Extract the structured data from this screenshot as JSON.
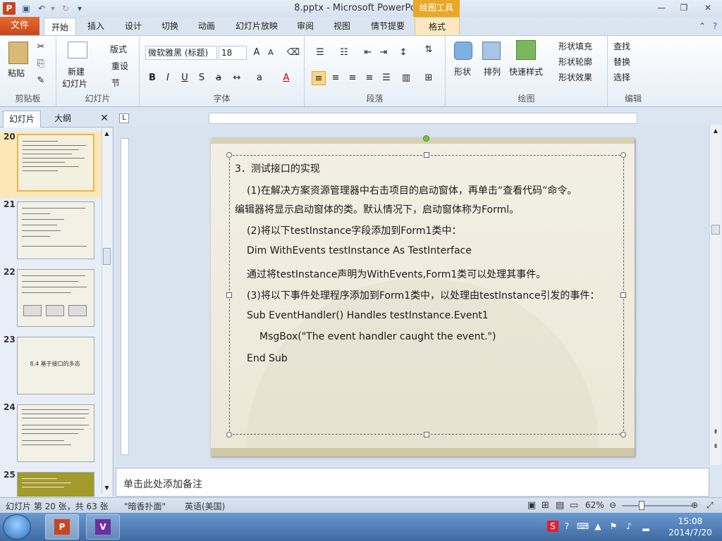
{
  "titlebar": {
    "title": "8.pptx - Microsoft PowerPoint",
    "context_tool": "绘图工具"
  },
  "tabs": {
    "file": "文件",
    "home": "开始",
    "insert": "插入",
    "design": "设计",
    "transitions": "切换",
    "animations": "动画",
    "slideshow": "幻灯片放映",
    "review": "审阅",
    "view": "视图",
    "storyboard": "情节提要",
    "format": "格式"
  },
  "ribbon": {
    "clipboard": {
      "label": "剪贴板",
      "paste": "粘贴"
    },
    "slides": {
      "label": "幻灯片",
      "new_slide_1": "新建",
      "new_slide_2": "幻灯片",
      "layout": "版式",
      "reset": "重设",
      "section": "节"
    },
    "font": {
      "label": "字体",
      "font_name": "微软雅黑 (标题)",
      "font_size": "18"
    },
    "paragraph": {
      "label": "段落"
    },
    "drawing": {
      "label": "绘图",
      "shape": "形状",
      "arrange": "排列",
      "quick_styles": "快速样式",
      "shape_fill": "形状填充",
      "shape_outline": "形状轮廓",
      "shape_effects": "形状效果"
    },
    "editing": {
      "label": "编辑",
      "find": "查找",
      "replace": "替换",
      "select": "选择"
    }
  },
  "leftpanel": {
    "tab_slides": "幻灯片",
    "tab_outline": "大纲",
    "thumbs": [
      {
        "num": "20",
        "text": ""
      },
      {
        "num": "21",
        "text": ""
      },
      {
        "num": "22",
        "text": ""
      },
      {
        "num": "23",
        "text": "8.4  基于接口的多态"
      },
      {
        "num": "24",
        "text": ""
      },
      {
        "num": "25",
        "text": ""
      }
    ]
  },
  "slide": {
    "lines": [
      "3．测试接口的实现",
      "(1)在解决方案资源管理器中右击项目的启动窗体，再单击“查看代码”命令。",
      "编辑器将显示启动窗体的类。默认情况下，启动窗体称为Forml。",
      "(2)将以下testInstance字段添加到Form1类中：",
      "Dim WithEvents testInstance As TestInterface",
      "通过将testInstance声明为WithEvents,Form1类可以处理其事件。",
      "(3)将以下事件处理程序添加到Form1类中，以处理由testInstance引发的事件：",
      "Sub EventHandler() Handles testInstance.Event1",
      "MsgBox(\"The event handler caught the event.\")",
      "End Sub"
    ]
  },
  "notes": {
    "placeholder": "单击此处添加备注"
  },
  "status": {
    "slide_info": "幻灯片 第 20 张，共 63 张",
    "theme": "\"暗香扑面\"",
    "language": "英语(美国)",
    "zoom": "62%"
  },
  "taskbar": {
    "time": "15:08",
    "date": "2014/7/20"
  }
}
